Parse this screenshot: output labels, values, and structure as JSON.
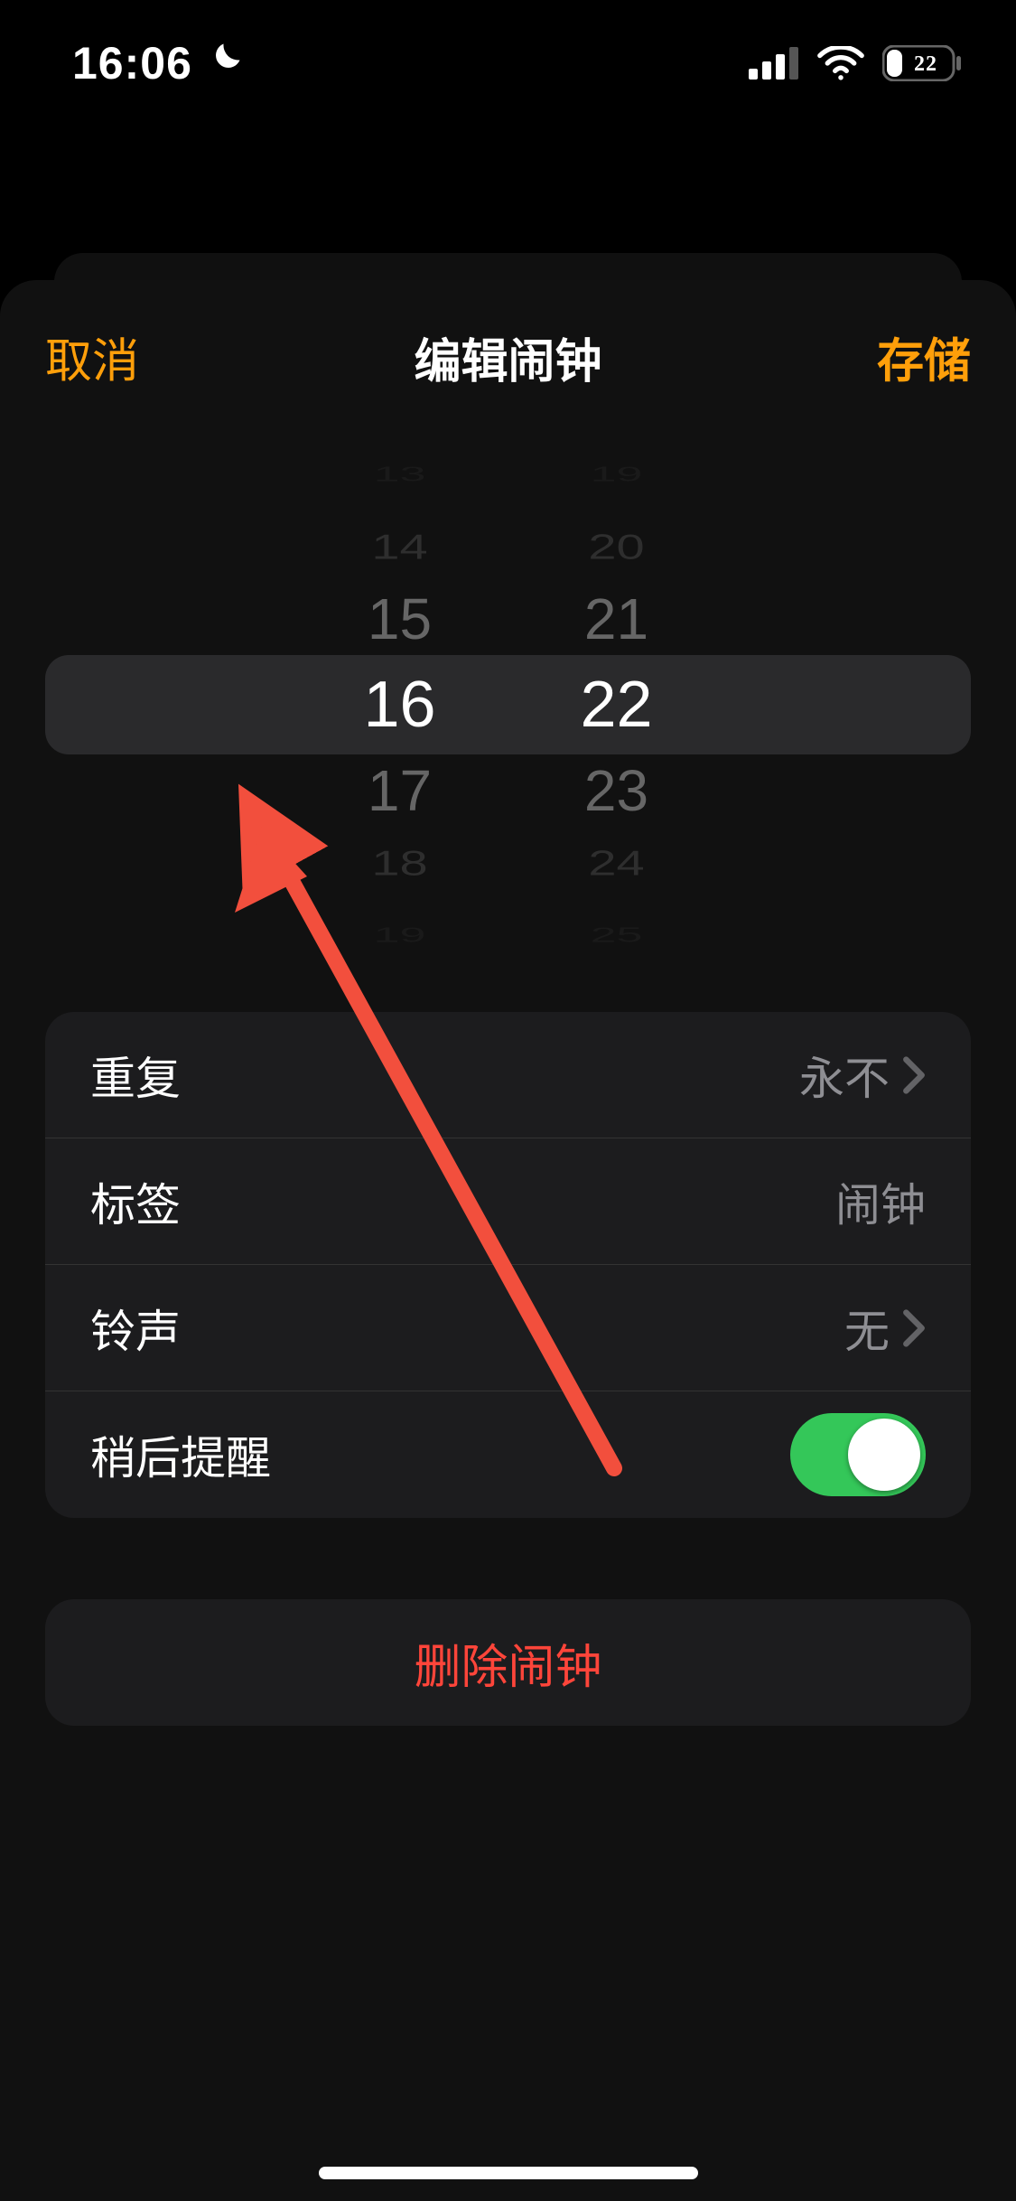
{
  "status": {
    "time": "16:06",
    "battery_percent": "22"
  },
  "nav": {
    "cancel": "取消",
    "title": "编辑闹钟",
    "save": "存储"
  },
  "picker": {
    "hours": [
      "13",
      "14",
      "15",
      "16",
      "17",
      "18",
      "19"
    ],
    "minutes": [
      "19",
      "20",
      "21",
      "22",
      "23",
      "24",
      "25"
    ],
    "selected_hour": "16",
    "selected_minute": "22"
  },
  "settings": {
    "repeat": {
      "label": "重复",
      "value": "永不"
    },
    "tag": {
      "label": "标签",
      "value": "闹钟"
    },
    "sound": {
      "label": "铃声",
      "value": "无"
    },
    "snooze": {
      "label": "稍后提醒",
      "on": true
    }
  },
  "delete_label": "删除闹钟"
}
